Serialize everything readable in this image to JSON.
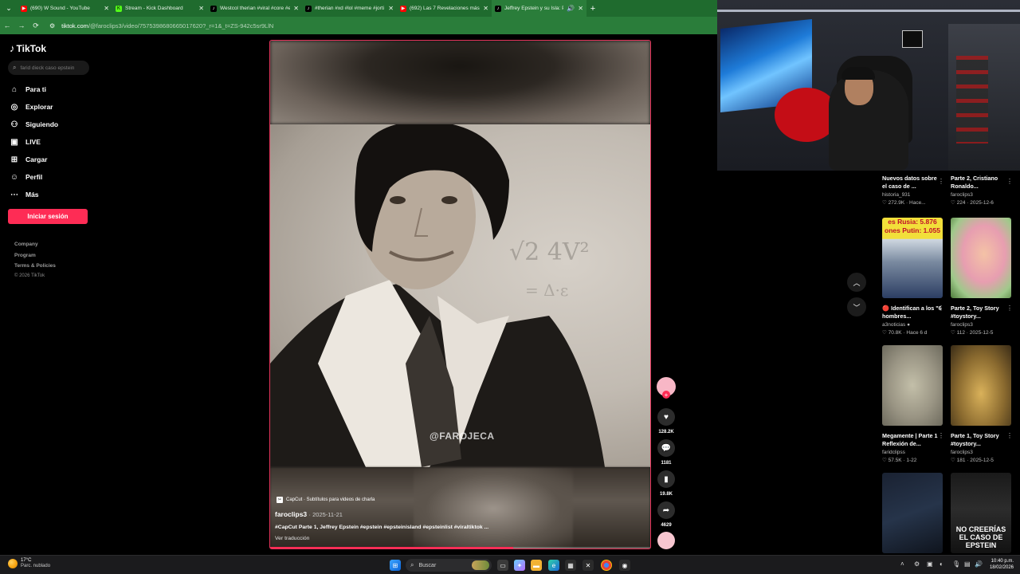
{
  "browser": {
    "tabs": [
      {
        "title": "(690) W Sound - YouTube",
        "icon": "youtube-icon",
        "color": "#ff0000",
        "glyph": "▶"
      },
      {
        "title": "Stream - Kick Dashboard",
        "icon": "kick-icon",
        "color": "#53fc18",
        "glyph": "K"
      },
      {
        "title": "Westcol therian #viral #core #e",
        "icon": "tiktok-icon",
        "color": "#000000",
        "glyph": "♪"
      },
      {
        "title": "#therian #xd #lol #meme #jorti",
        "icon": "tiktok-icon",
        "color": "#000000",
        "glyph": "♪"
      },
      {
        "title": "(692) Las 7 Revelaciones más p",
        "icon": "youtube-icon",
        "color": "#ff0000",
        "glyph": "▶"
      },
      {
        "title": "Jeffrey Epstein y su Isla: Par",
        "icon": "tiktok-icon",
        "color": "#000000",
        "glyph": "♪"
      }
    ],
    "url_host": "tiktok.com",
    "url_path": "/@faroclips3/video/7575398680665017620?_r=1&_t=ZS-942c5sr9LlN"
  },
  "sidebar": {
    "logo": "TikTok",
    "search_placeholder": "farid dieck caso epstein",
    "nav": [
      {
        "label": "Para ti",
        "icon": "home-icon",
        "glyph": "⌂"
      },
      {
        "label": "Explorar",
        "icon": "compass-icon",
        "glyph": "◎"
      },
      {
        "label": "Siguiendo",
        "icon": "following-icon",
        "glyph": "👤"
      },
      {
        "label": "LIVE",
        "icon": "live-icon",
        "glyph": "▣"
      },
      {
        "label": "Cargar",
        "icon": "upload-icon",
        "glyph": "⊞"
      },
      {
        "label": "Perfil",
        "icon": "profile-icon",
        "glyph": "👤"
      },
      {
        "label": "Más",
        "icon": "more-icon",
        "glyph": "···"
      }
    ],
    "login": "Iniciar sesión",
    "footer": [
      "Company",
      "Program",
      "Terms & Policies"
    ],
    "copyright": "© 2026 TikTok"
  },
  "video": {
    "watermark": "@FAROJECA",
    "capcut": "CapCut · Subtítulos para videos de charla",
    "author": "faroclips3",
    "date": "· 2025-11-21",
    "caption": "#CapCut Parte 1, Jeffrey Epstein #epstein #epsteinisland #epsteinlist #viraltiktok ...",
    "translate": "Ver traducción",
    "progress": 0.64,
    "likes": "128.2K",
    "comments": "1181",
    "saves": "19.8K",
    "shares": "4629",
    "accent": "#fe2c55"
  },
  "related": [
    {
      "title": "Nuevos datos sobre el caso de ...",
      "author": "historia_931",
      "meta": "♡ 272.9K · Hace..."
    },
    {
      "title": "Parte 2, Cristiano Ronaldo...",
      "author": "faroclips3",
      "meta": "♡ 224 · 2025-12-6"
    },
    {
      "title": "🔴 Identifican a los \"6 hombres...",
      "author": "a3noticias ●",
      "meta": "♡ 70.8K · Hace 6 d",
      "thumb_text": "es Rusia: 5.876 ones Putin: 1.055"
    },
    {
      "title": "Parte 2, Toy Story #toystory...",
      "author": "faroclips3",
      "meta": "♡ 112 · 2025-12-5"
    },
    {
      "title": "Megamente | Parte 1 Reflexión de...",
      "author": "faridclipss",
      "meta": "♡ 57.5K · 1-22"
    },
    {
      "title": "Parte 1, Toy Story #toystory...",
      "author": "faroclips3",
      "meta": "♡ 181 · 2025-12-5"
    },
    {
      "title": "",
      "author": "",
      "meta": ""
    },
    {
      "title": "",
      "author": "",
      "meta": "",
      "thumb_text": "NO CREERÍAS EL CASO DE EPSTEIN"
    }
  ],
  "taskbar": {
    "temp": "17°C",
    "weather": "Parc. nublado",
    "search": "Buscar",
    "time": "10:40 p.m.",
    "date": "18/02/2026"
  }
}
